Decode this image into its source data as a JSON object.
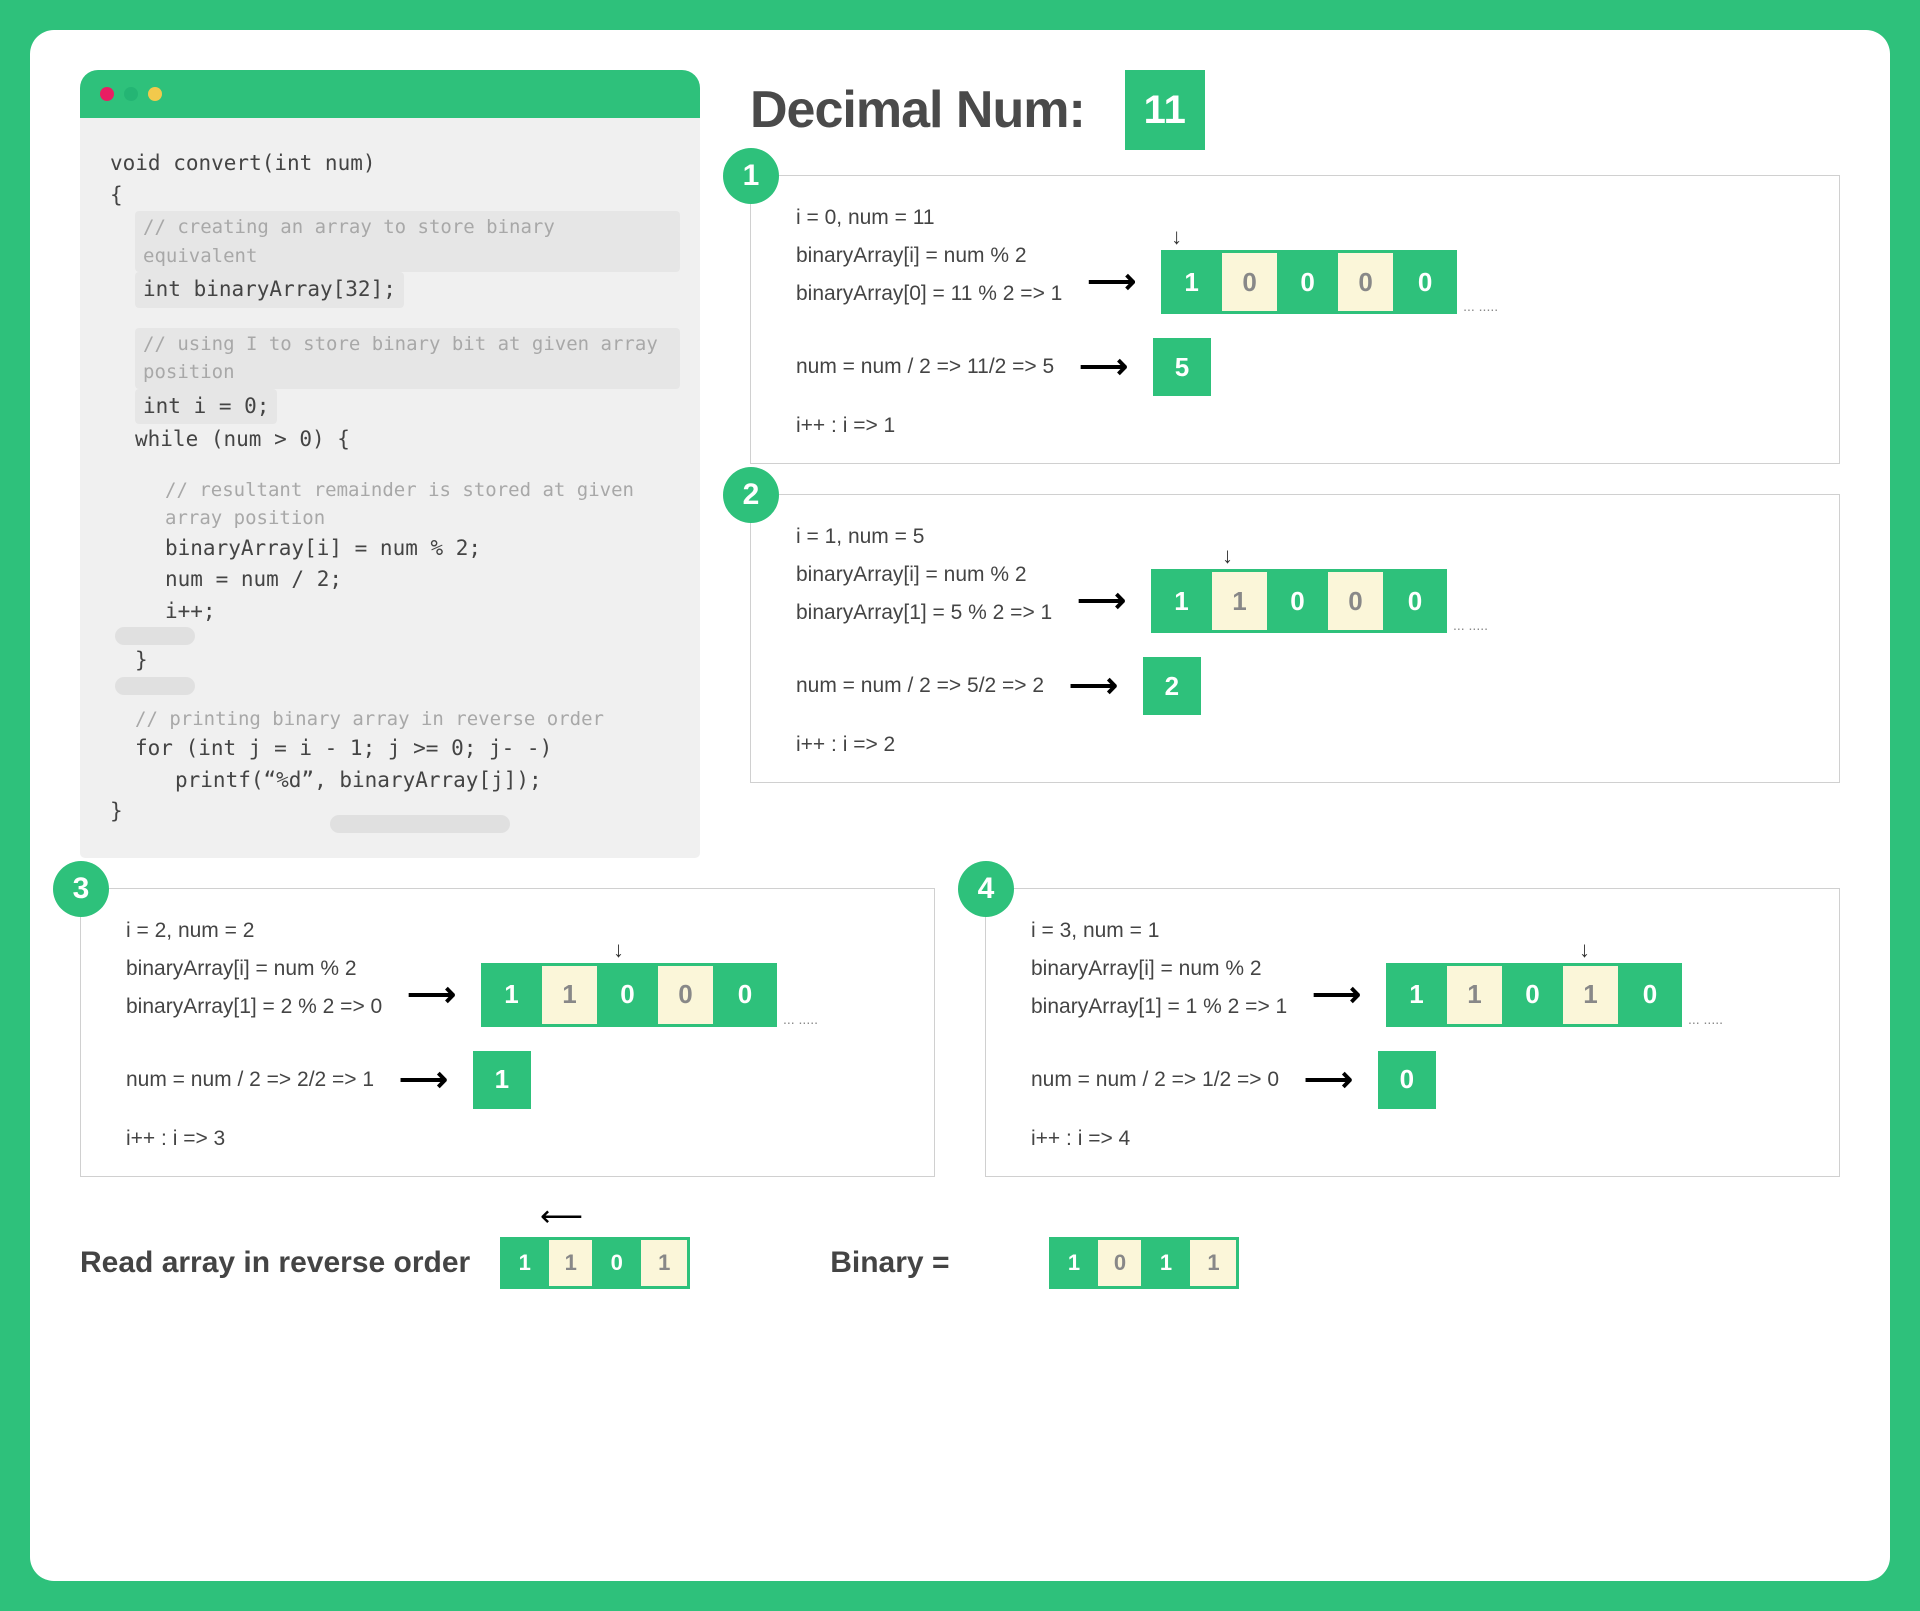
{
  "header": {
    "title": "Decimal Num:",
    "value": "11"
  },
  "dots": {
    "red": "#e91e63",
    "green": "#2ec17b",
    "yellow": "#f2c94c"
  },
  "code": {
    "sig": "void convert(int num)",
    "brace_open": "{",
    "c1": "// creating an array to store binary equivalent",
    "l1": "int binaryArray[32];",
    "c2": "// using I to store binary bit at given array position",
    "l2": "int i = 0;",
    "l3": "while (num > 0) {",
    "c3": "// resultant remainder is stored at given array position",
    "l4": "binaryArray[i] = num % 2;",
    "l5": "num = num / 2;",
    "l6": "i++;",
    "l7": "}",
    "c4": "// printing binary array in reverse order",
    "l8": "for (int j = i - 1; j >= 0; j- -)",
    "l9": "printf(“%d”, binaryArray[j]);",
    "brace_close": "}"
  },
  "steps": [
    {
      "num": "1",
      "header": "i = 0, num = 11",
      "expr1": "binaryArray[i] = num % 2",
      "expr2": "binaryArray[0] = 11 % 2 => 1",
      "array": [
        "1",
        "0",
        "0",
        "0",
        "0"
      ],
      "colors": [
        "g",
        "y",
        "g",
        "y",
        "g"
      ],
      "pointer_idx": 0,
      "num_expr": "num = num / 2 => 11/2 => 5",
      "num_val": "5",
      "inc": "i++ : i => 1"
    },
    {
      "num": "2",
      "header": "i = 1, num = 5",
      "expr1": "binaryArray[i] = num % 2",
      "expr2": "binaryArray[1] = 5 % 2 => 1",
      "array": [
        "1",
        "1",
        "0",
        "0",
        "0"
      ],
      "colors": [
        "g",
        "y",
        "g",
        "y",
        "g"
      ],
      "pointer_idx": 1,
      "num_expr": "num = num / 2 => 5/2 => 2",
      "num_val": "2",
      "inc": "i++ : i => 2"
    },
    {
      "num": "3",
      "header": "i = 2, num = 2",
      "expr1": "binaryArray[i] = num % 2",
      "expr2": "binaryArray[1] = 2 % 2 => 0",
      "array": [
        "1",
        "1",
        "0",
        "0",
        "0"
      ],
      "colors": [
        "g",
        "y",
        "g",
        "y",
        "g"
      ],
      "pointer_idx": 2,
      "num_expr": "num = num / 2 => 2/2 => 1",
      "num_val": "1",
      "inc": "i++ : i => 3"
    },
    {
      "num": "4",
      "header": "i = 3, num = 1",
      "expr1": "binaryArray[i] = num % 2",
      "expr2": "binaryArray[1] = 1 % 2 => 1",
      "array": [
        "1",
        "1",
        "0",
        "1",
        "0"
      ],
      "colors": [
        "g",
        "y",
        "g",
        "y",
        "g"
      ],
      "pointer_idx": 3,
      "num_expr": "num = num / 2 => 1/2 => 0",
      "num_val": "0",
      "inc": "i++ : i => 4"
    }
  ],
  "result": {
    "reverse_label": "Read array in reverse order",
    "reverse_arr": [
      "1",
      "1",
      "0",
      "1"
    ],
    "reverse_colors": [
      "g",
      "y",
      "g",
      "y"
    ],
    "binary_label": "Binary  =",
    "binary_arr": [
      "1",
      "0",
      "1",
      "1"
    ],
    "binary_colors": [
      "g",
      "y",
      "g",
      "y"
    ]
  },
  "ellipsis": "... ....."
}
